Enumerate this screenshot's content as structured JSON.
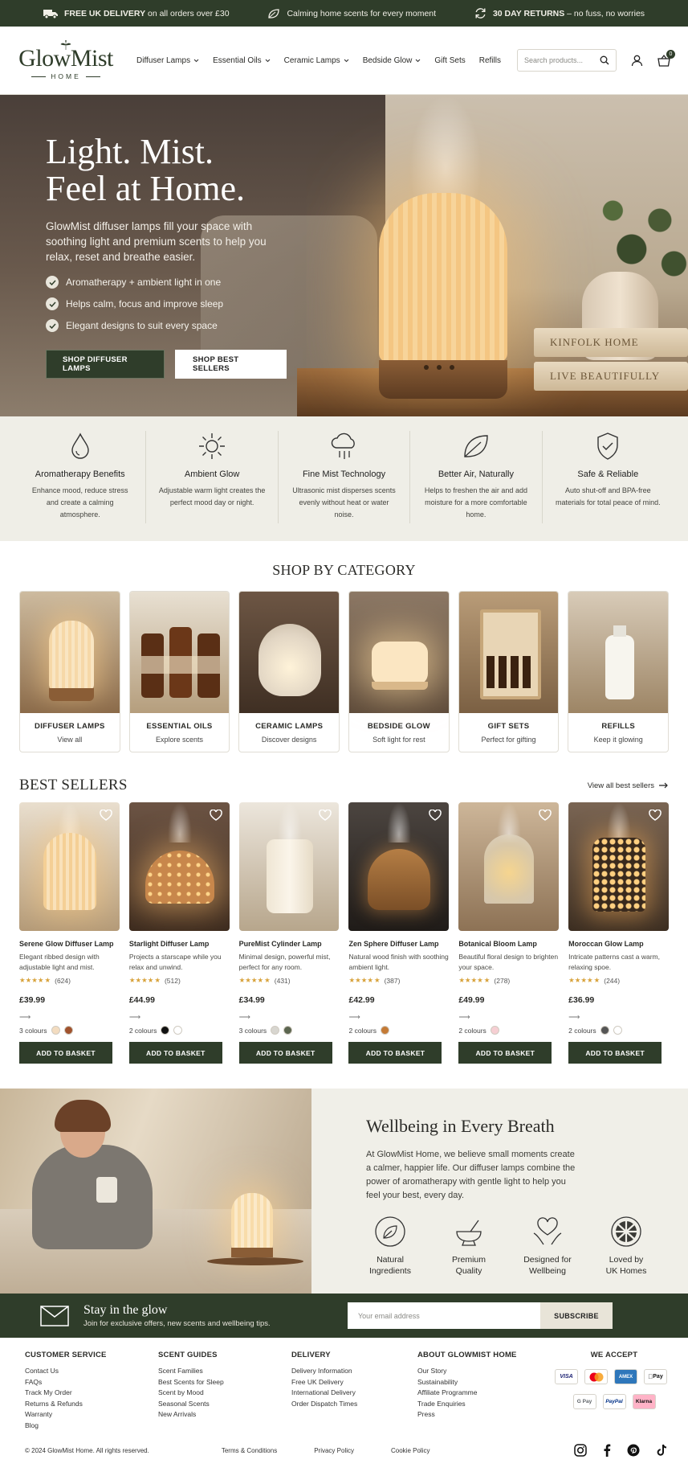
{
  "promo": {
    "items": [
      {
        "bold": "FREE UK DELIVERY",
        "text": " on all orders over £30"
      },
      {
        "bold": "",
        "text": "Calming home scents for every moment"
      },
      {
        "bold": "30 DAY RETURNS",
        "text": " – no fuss, no worries"
      }
    ]
  },
  "header": {
    "logo_name": "GlowMist",
    "logo_sub": "HOME",
    "nav": [
      "Diffuser Lamps",
      "Essential Oils",
      "Ceramic Lamps",
      "Bedside Glow",
      "Gift Sets",
      "Refills"
    ],
    "search_placeholder": "Search products...",
    "cart_count": "0"
  },
  "hero": {
    "title_line1": "Light. Mist.",
    "title_line2": "Feel at Home.",
    "subtitle": "GlowMist diffuser lamps fill your space with soothing light and premium scents to help you relax, reset and breathe easier.",
    "bullets": [
      "Aromatherapy + ambient light in one",
      "Helps calm, focus and improve sleep",
      "Elegant designs to suit every space"
    ],
    "btn_primary": "SHOP DIFFUSER LAMPS",
    "btn_secondary": "SHOP BEST SELLERS",
    "book1": "KINFOLK HOME",
    "book2": "LIVE BEAUTIFULLY"
  },
  "features": [
    {
      "title": "Aromatherapy Benefits",
      "text": "Enhance mood, reduce stress and create a calming atmosphere.",
      "icon": "drop-icon"
    },
    {
      "title": "Ambient Glow",
      "text": "Adjustable warm light creates the perfect mood day or night.",
      "icon": "sun-icon"
    },
    {
      "title": "Fine Mist Technology",
      "text": "Ultrasonic mist disperses scents evenly without heat or water noise.",
      "icon": "mist-cloud-icon"
    },
    {
      "title": "Better Air, Naturally",
      "text": "Helps to freshen the air and add moisture for a more comfortable home.",
      "icon": "leaf-icon"
    },
    {
      "title": "Safe & Reliable",
      "text": "Auto shut-off and BPA-free materials for total peace of mind.",
      "icon": "shield-check-icon"
    }
  ],
  "categories": {
    "title": "SHOP BY CATEGORY",
    "items": [
      {
        "title": "DIFFUSER LAMPS",
        "sub": "View all"
      },
      {
        "title": "ESSENTIAL OILS",
        "sub": "Explore scents"
      },
      {
        "title": "CERAMIC LAMPS",
        "sub": "Discover designs"
      },
      {
        "title": "BEDSIDE GLOW",
        "sub": "Soft light for rest"
      },
      {
        "title": "GIFT SETS",
        "sub": "Perfect for gifting"
      },
      {
        "title": "REFILLS",
        "sub": "Keep it glowing"
      }
    ]
  },
  "bestsellers": {
    "title": "BEST SELLERS",
    "view_all": "View all best sellers",
    "add_label": "ADD TO BASKET",
    "products": [
      {
        "name": "Serene Glow Diffuser Lamp",
        "desc": "Elegant ribbed design with adjustable light and mist.",
        "reviews": "(624)",
        "rating": 4.5,
        "price": "£39.99",
        "colours": "3 colours",
        "swatches": [
          "#f3dcc0",
          "#a0522d"
        ]
      },
      {
        "name": "Starlight Diffuser Lamp",
        "desc": "Projects a starscape while you relax and unwind.",
        "reviews": "(512)",
        "rating": 4.5,
        "price": "£44.99",
        "colours": "2 colours",
        "swatches": [
          "#111111",
          "#ffffff"
        ]
      },
      {
        "name": "PureMist Cylinder Lamp",
        "desc": "Minimal design, powerful mist, perfect for any room.",
        "reviews": "(431)",
        "rating": 4.5,
        "price": "£34.99",
        "colours": "3 colours",
        "swatches": [
          "#d8d6d0",
          "#5c6650"
        ]
      },
      {
        "name": "Zen Sphere Diffuser Lamp",
        "desc": "Natural wood finish with soothing ambient light.",
        "reviews": "(387)",
        "rating": 4.5,
        "price": "£42.99",
        "colours": "2 colours",
        "swatches": [
          "#c47a35"
        ]
      },
      {
        "name": "Botanical Bloom Lamp",
        "desc": "Beautiful floral design to brighten your space.",
        "reviews": "(278)",
        "rating": 4.5,
        "price": "£49.99",
        "colours": "2 colours",
        "swatches": [
          "#f6cfd3"
        ]
      },
      {
        "name": "Moroccan Glow Lamp",
        "desc": "Intricate patterns cast a warm, relaxing spoe.",
        "reviews": "(244)",
        "rating": 4.5,
        "price": "£36.99",
        "colours": "2 colours",
        "swatches": [
          "#555555",
          "#ffffff"
        ]
      }
    ]
  },
  "wellbeing": {
    "title": "Wellbeing in Every Breath",
    "body": "At GlowMist Home, we believe small moments create a calmer, happier life. Our diffuser lamps combine the power of aromatherapy with gentle light to help you feel your best, every day.",
    "badges": [
      {
        "line1": "Natural",
        "line2": "Ingredients",
        "icon": "leaf-circle-icon"
      },
      {
        "line1": "Premium",
        "line2": "Quality",
        "icon": "mortar-icon"
      },
      {
        "line1": "Designed for",
        "line2": "Wellbeing",
        "icon": "heart-hands-icon"
      },
      {
        "line1": "Loved by",
        "line2": "UK Homes",
        "icon": "uk-flag-icon"
      }
    ]
  },
  "newsletter": {
    "title": "Stay in the glow",
    "sub": "Join for exclusive offers, new scents and wellbeing tips.",
    "placeholder": "Your email address",
    "button": "SUBSCRIBE"
  },
  "footer": {
    "columns": [
      {
        "title": "CUSTOMER SERVICE",
        "links": [
          "Contact Us",
          "FAQs",
          "Track My Order",
          "Returns & Refunds",
          "Warranty",
          "Blog"
        ]
      },
      {
        "title": "SCENT GUIDES",
        "links": [
          "Scent Families",
          "Best Scents for Sleep",
          "Scent by Mood",
          "Seasonal Scents",
          "New Arrivals"
        ]
      },
      {
        "title": "DELIVERY",
        "links": [
          "Delivery Information",
          "Free UK Delivery",
          "International Delivery",
          "Order Dispatch Times"
        ]
      },
      {
        "title": "ABOUT GLOWMIST HOME",
        "links": [
          "Our Story",
          "Sustainability",
          "Affiliate Programme",
          "Trade Enquiries",
          "Press"
        ]
      }
    ],
    "pay_title": "WE ACCEPT",
    "pay_row1": [
      "VISA",
      "",
      "AMEX",
      "Pay"
    ],
    "pay_row2": [
      "G Pay",
      "PayPal",
      "Klarna"
    ],
    "copyright": "© 2024 GlowMist Home. All rights reserved.",
    "legal": [
      "Terms & Conditions",
      "Privacy Policy",
      "Cookie Policy"
    ],
    "colors": {
      "brand": "#2f3d2a",
      "cream": "#efeee7",
      "star": "#d8a23a"
    }
  }
}
